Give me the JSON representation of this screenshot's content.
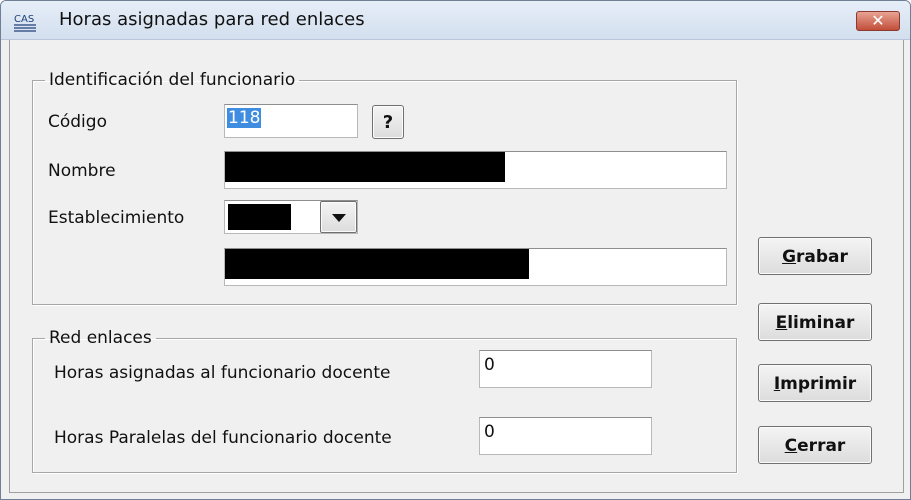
{
  "window": {
    "title": "Horas asignadas para red enlaces",
    "icon_label": "CAS",
    "close_glyph": "✕"
  },
  "identificacion": {
    "legend": "Identificación del funcionario",
    "codigo_label": "Código",
    "codigo_value": "118",
    "lookup_label": "?",
    "nombre_label": "Nombre",
    "establecimiento_label": "Establecimiento",
    "dropdown_icon": "chevron-down-icon"
  },
  "red": {
    "legend": "Red enlaces",
    "horas_asignadas_label": "Horas asignadas al funcionario docente",
    "horas_asignadas_value": "0",
    "horas_paralelas_label": "Horas Paralelas del funcionario docente",
    "horas_paralelas_value": "0"
  },
  "buttons": {
    "grabar": {
      "first": "G",
      "rest": "rabar"
    },
    "eliminar": {
      "first": "E",
      "rest": "liminar"
    },
    "imprimir": {
      "first": "I",
      "rest": "mprimir"
    },
    "cerrar": {
      "first": "C",
      "rest": "errar"
    }
  }
}
